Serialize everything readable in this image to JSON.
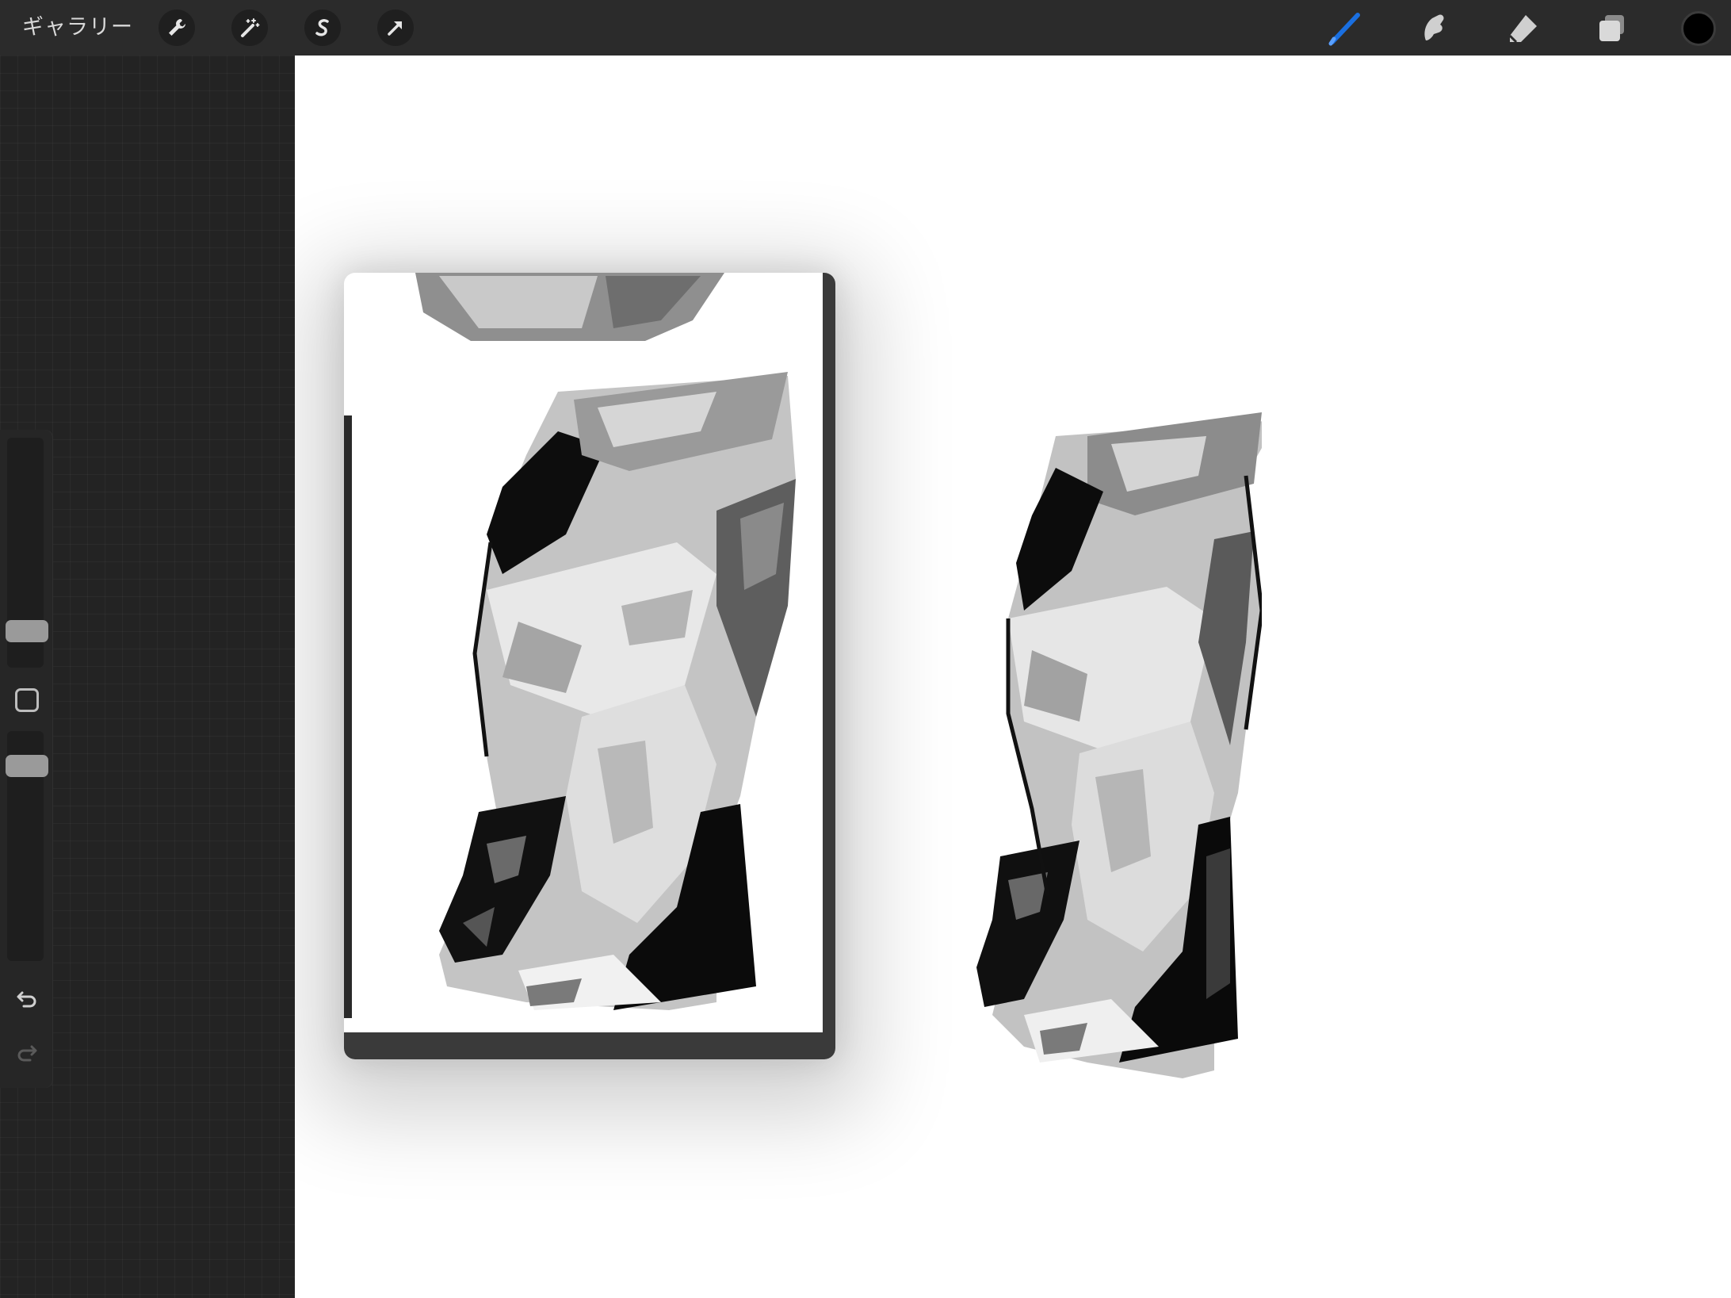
{
  "toolbar": {
    "gallery_label": "ギャラリー",
    "left_tools": [
      "wrench-icon",
      "magic-wand-icon",
      "selection-icon",
      "transform-arrow-icon"
    ],
    "right_tools": [
      "brush-icon",
      "smudge-icon",
      "eraser-icon",
      "layers-icon"
    ],
    "active_tool": "brush-icon",
    "active_color": "#000000",
    "accent_color": "#1a6fe0"
  },
  "sidebar": {
    "brush_size_level": 0.38,
    "opacity_level": 0.62,
    "buttons": [
      "modify-square-icon",
      "undo-icon",
      "redo-icon"
    ]
  },
  "canvas": {
    "background": "#ffffff",
    "reference_window": "reference-image",
    "artwork": "grayscale-torso-sketch"
  }
}
